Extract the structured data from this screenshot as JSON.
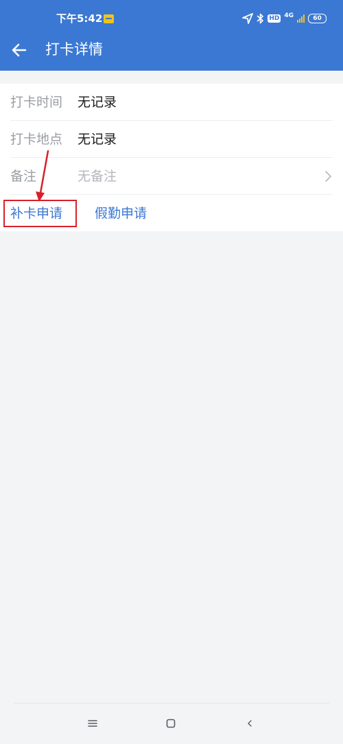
{
  "status_bar": {
    "time": "下午5:42",
    "notification_icon": "app-notification-icon",
    "icons": [
      "location-icon",
      "bluetooth-icon",
      "hd-icon",
      "signal-icon",
      "battery-icon"
    ],
    "hd_label": "HD",
    "network": "4G",
    "battery": "60"
  },
  "header": {
    "title": "打卡详情",
    "back_icon": "back-arrow-icon",
    "background": "#3b78d3"
  },
  "details": {
    "time_label": "打卡时间",
    "time_value": "无记录",
    "location_label": "打卡地点",
    "location_value": "无记录",
    "remark_label": "备注",
    "remark_value": "无备注"
  },
  "actions": {
    "makeup_punch": "补卡申请",
    "leave_request": "假勤申请",
    "link_color": "#3b78d3"
  },
  "annotation": {
    "color": "#d6202a"
  },
  "nav_bar": {
    "icons": [
      "menu-icon",
      "home-icon",
      "back-icon"
    ]
  }
}
